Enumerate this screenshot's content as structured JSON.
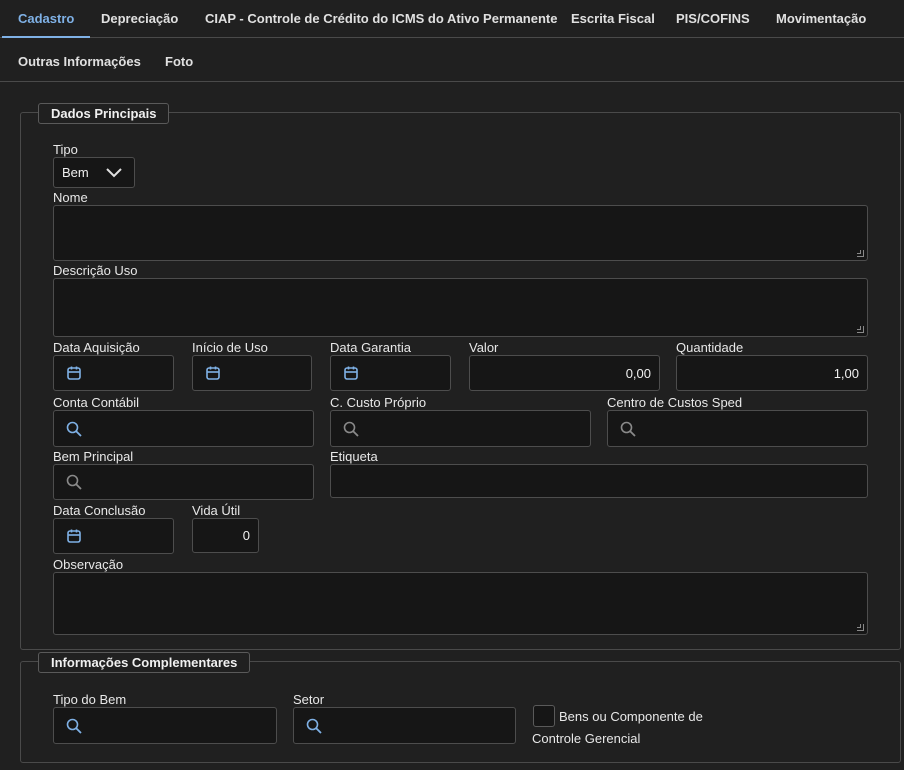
{
  "tabs_row1": [
    {
      "label": "Cadastro",
      "active": true
    },
    {
      "label": "Depreciação"
    },
    {
      "label": "CIAP - Controle de Crédito do ICMS do Ativo Permanente"
    },
    {
      "label": "Escrita Fiscal"
    },
    {
      "label": "PIS/COFINS"
    },
    {
      "label": "Movimentação"
    }
  ],
  "tabs_row2": [
    {
      "label": "Outras Informações"
    },
    {
      "label": "Foto"
    }
  ],
  "dados_principais": {
    "legend": "Dados Principais",
    "tipo": {
      "label": "Tipo",
      "value": "Bem"
    },
    "nome": {
      "label": "Nome",
      "value": ""
    },
    "descricao_uso": {
      "label": "Descrição Uso",
      "value": ""
    },
    "data_aquisicao": {
      "label": "Data Aquisição",
      "value": ""
    },
    "inicio_uso": {
      "label": "Início de Uso",
      "value": ""
    },
    "data_garantia": {
      "label": "Data Garantia",
      "value": ""
    },
    "valor": {
      "label": "Valor",
      "value": "0,00"
    },
    "quantidade": {
      "label": "Quantidade",
      "value": "1,00"
    },
    "conta_contabil": {
      "label": "Conta Contábil",
      "value": ""
    },
    "c_custo_proprio": {
      "label": "C. Custo Próprio",
      "value": ""
    },
    "centro_custos_sped": {
      "label": "Centro de Custos Sped",
      "value": ""
    },
    "bem_principal": {
      "label": "Bem Principal",
      "value": ""
    },
    "etiqueta": {
      "label": "Etiqueta",
      "value": ""
    },
    "data_conclusao": {
      "label": "Data Conclusão",
      "value": ""
    },
    "vida_util": {
      "label": "Vida Útil",
      "value": "0"
    },
    "observacao": {
      "label": "Observação",
      "value": ""
    }
  },
  "info_complementares": {
    "legend": "Informações Complementares",
    "tipo_bem": {
      "label": "Tipo do Bem",
      "value": ""
    },
    "setor": {
      "label": "Setor",
      "value": ""
    },
    "controle_gerencial": {
      "label_line1": "Bens ou Componente de",
      "label_line2": "Controle Gerencial",
      "checked": false
    }
  },
  "icons": {
    "calendar": "calendar-icon",
    "search": "search-icon",
    "chevron": "chevron-down-icon"
  },
  "colors": {
    "accent": "#7fb1e6",
    "background": "#202020",
    "field": "#161616"
  }
}
